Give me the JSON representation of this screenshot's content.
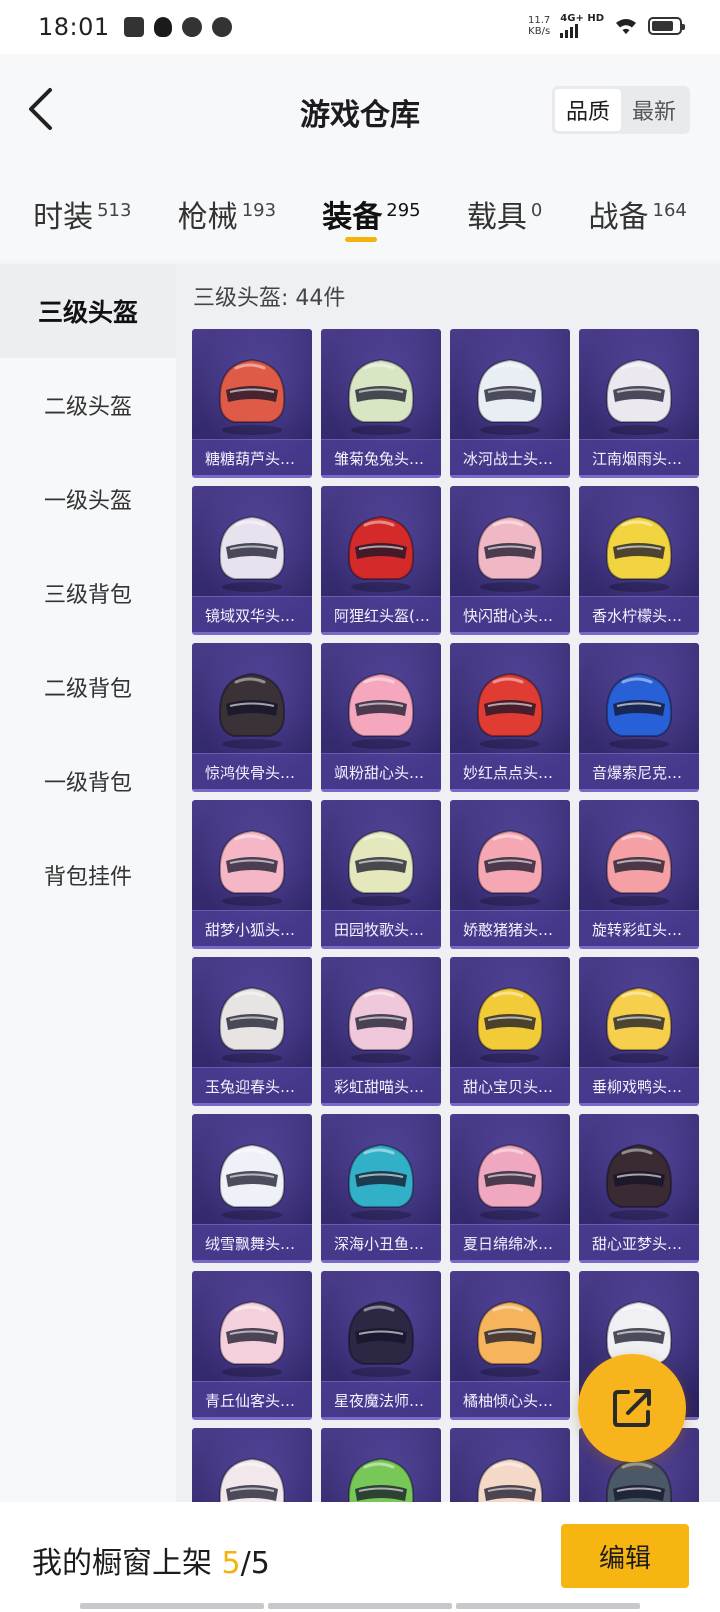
{
  "status_bar": {
    "time": "18:01",
    "net_speed_value": "11.7",
    "net_speed_unit": "KB/s",
    "net_type": "4G+ HD"
  },
  "header": {
    "title": "游戏仓库",
    "sort_options": [
      "品质",
      "最新"
    ],
    "active_sort": "品质"
  },
  "category_tabs": [
    {
      "label": "时装",
      "count": "513"
    },
    {
      "label": "枪械",
      "count": "193"
    },
    {
      "label": "装备",
      "count": "295",
      "active": true
    },
    {
      "label": "载具",
      "count": "0"
    },
    {
      "label": "战备",
      "count": "164"
    }
  ],
  "sidebar": {
    "items": [
      "三级头盔",
      "二级头盔",
      "一级头盔",
      "三级背包",
      "二级背包",
      "一级背包",
      "背包挂件"
    ],
    "active": "三级头盔"
  },
  "content": {
    "section_title": "三级头盔: 44件",
    "items": [
      {
        "name": "糖糖葫芦头…",
        "icon": "helmet-icon",
        "color": "#e05a48"
      },
      {
        "name": "雏菊兔兔头…",
        "icon": "helmet-icon",
        "color": "#d8e6c4"
      },
      {
        "name": "冰河战士头…",
        "icon": "helmet-icon",
        "color": "#e9eef4"
      },
      {
        "name": "江南烟雨头…",
        "icon": "helmet-icon",
        "color": "#ece8f0"
      },
      {
        "name": "镜域双华头…",
        "icon": "helmet-icon",
        "color": "#e7e2ee"
      },
      {
        "name": "阿狸红头盔(…",
        "icon": "helmet-icon",
        "color": "#d42a2a"
      },
      {
        "name": "快闪甜心头…",
        "icon": "helmet-icon",
        "color": "#f0b8c4"
      },
      {
        "name": "香水柠檬头…",
        "icon": "helmet-icon",
        "color": "#f2d440"
      },
      {
        "name": "惊鸿侠骨头…",
        "icon": "helmet-icon",
        "color": "#3a3236"
      },
      {
        "name": "飒粉甜心头…",
        "icon": "helmet-icon",
        "color": "#f4a7bd"
      },
      {
        "name": "妙红点点头…",
        "icon": "helmet-icon",
        "color": "#e03c34"
      },
      {
        "name": "音爆索尼克…",
        "icon": "helmet-icon",
        "color": "#2860d8"
      },
      {
        "name": "甜梦小狐头…",
        "icon": "helmet-icon",
        "color": "#f5b6c6"
      },
      {
        "name": "田园牧歌头…",
        "icon": "helmet-icon",
        "color": "#e4e8bc"
      },
      {
        "name": "娇憨猪猪头…",
        "icon": "helmet-icon",
        "color": "#f5a8b4"
      },
      {
        "name": "旋转彩虹头…",
        "icon": "helmet-icon",
        "color": "#f4a0a4"
      },
      {
        "name": "玉兔迎春头…",
        "icon": "helmet-icon",
        "color": "#e8e4e4"
      },
      {
        "name": "彩虹甜喵头…",
        "icon": "helmet-icon",
        "color": "#f0c8dc"
      },
      {
        "name": "甜心宝贝头…",
        "icon": "helmet-icon",
        "color": "#f2cc38"
      },
      {
        "name": "垂柳戏鸭头…",
        "icon": "helmet-icon",
        "color": "#f6cf4c"
      },
      {
        "name": "绒雪飘舞头…",
        "icon": "helmet-icon",
        "color": "#eef2f8"
      },
      {
        "name": "深海小丑鱼…",
        "icon": "helmet-icon",
        "color": "#32b0c8"
      },
      {
        "name": "夏日绵绵冰…",
        "icon": "helmet-icon",
        "color": "#f0a8c0"
      },
      {
        "name": "甜心亚梦头…",
        "icon": "helmet-icon",
        "color": "#3a2a34"
      },
      {
        "name": "青丘仙客头…",
        "icon": "helmet-icon",
        "color": "#f4d0dc"
      },
      {
        "name": "星夜魔法师…",
        "icon": "helmet-icon",
        "color": "#2c2844"
      },
      {
        "name": "橘柚倾心头…",
        "icon": "helmet-icon",
        "color": "#f6b45c"
      },
      {
        "name": "",
        "icon": "helmet-icon",
        "color": "#f0f0f4"
      },
      {
        "name": "",
        "icon": "helmet-icon",
        "color": "#f2e8ec"
      },
      {
        "name": "",
        "icon": "helmet-icon",
        "color": "#78c858"
      },
      {
        "name": "",
        "icon": "helmet-icon",
        "color": "#f4d8c8"
      },
      {
        "name": "",
        "icon": "helmet-icon",
        "color": "#4a5868"
      }
    ]
  },
  "bottom_bar": {
    "showcase_label": "我的橱窗上架",
    "showcase_current": "5",
    "showcase_sep": "/",
    "showcase_total": "5",
    "edit_label": "编辑"
  },
  "colors": {
    "accent": "#f4b30b",
    "card_bg": "#3a2f78"
  }
}
